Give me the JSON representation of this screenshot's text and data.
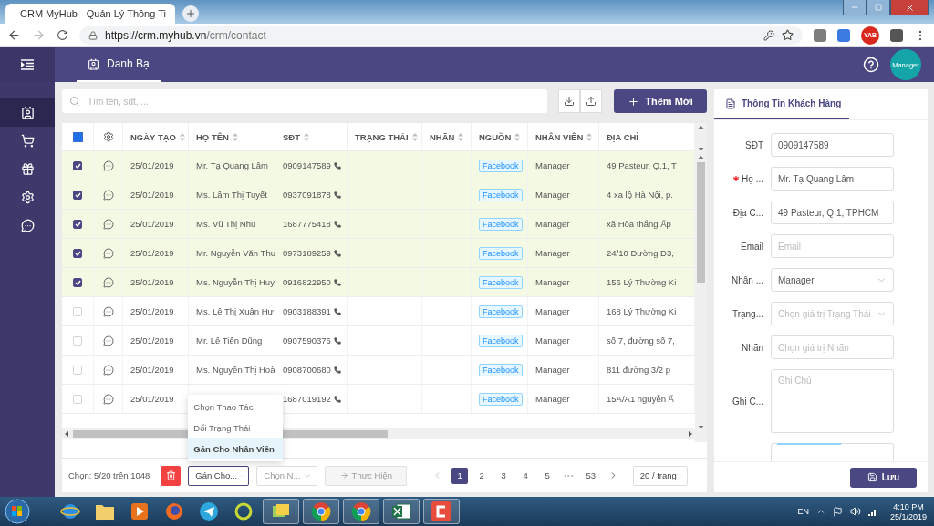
{
  "browser": {
    "tab_title": "CRM MyHub - Quản Lý Thông Ti",
    "url_host": "https://crm.myhub.vn",
    "url_path": "/crm/contact",
    "extension_badge": "YAB"
  },
  "header": {
    "tabs": [
      {
        "label": "Danh Bạ",
        "selected": true
      }
    ],
    "avatar": "Manager"
  },
  "sidebar": {
    "items": [
      {
        "kind": "contacts",
        "selected": true
      },
      {
        "kind": "cart",
        "selected": false
      },
      {
        "kind": "gift",
        "selected": false
      },
      {
        "kind": "settings",
        "selected": false
      },
      {
        "kind": "chat",
        "selected": false
      }
    ]
  },
  "toolbar": {
    "search": {
      "placeholder": "Tìm tên, sđt, ..."
    },
    "add_button": "Thêm Mới"
  },
  "table": {
    "select_all": {
      "indeterminate": true
    },
    "columns": [
      {
        "kind": "checkbox"
      },
      {
        "kind": "settings"
      },
      {
        "kind": "text",
        "label": "NGÀY TẠO",
        "sortable": true
      },
      {
        "kind": "text",
        "label": "HỌ TÊN",
        "sortable": true
      },
      {
        "kind": "text",
        "label": "SĐT",
        "sortable": true
      },
      {
        "kind": "text",
        "label": "TRẠNG THÁI",
        "sortable": true
      },
      {
        "kind": "text",
        "label": "NHÃN",
        "sortable": true
      },
      {
        "kind": "text",
        "label": "NGUỒN",
        "sortable": true
      },
      {
        "kind": "text",
        "label": "NHÂN VIÊN",
        "sortable": true
      },
      {
        "kind": "text",
        "label": "ĐỊA CHỈ",
        "sortable": false
      }
    ],
    "rows": [
      {
        "checked": true,
        "date": "25/01/2019",
        "name": "Mr. Tạ Quang Lâm",
        "phone": "0909147589",
        "source": "Facebook",
        "staff": "Manager",
        "address": "49 Pasteur, Q.1, T"
      },
      {
        "checked": true,
        "date": "25/01/2019",
        "name": "Ms. Lâm Thị Tuyết",
        "phone": "0937091878",
        "source": "Facebook",
        "staff": "Manager",
        "address": "4 xa lộ Hà Nội, p."
      },
      {
        "checked": true,
        "date": "25/01/2019",
        "name": "Ms. Vũ Thị Nhu",
        "phone": "1687775418",
        "source": "Facebook",
        "staff": "Manager",
        "address": "xã Hòa thắng Ấp"
      },
      {
        "checked": true,
        "date": "25/01/2019",
        "name": "Mr. Nguyễn Văn Thu",
        "phone": "0973189259",
        "source": "Facebook",
        "staff": "Manager",
        "address": "24/10 Đường D3,"
      },
      {
        "checked": true,
        "date": "25/01/2019",
        "name": "Ms. Nguyễn Thị Huy",
        "phone": "0916822950",
        "source": "Facebook",
        "staff": "Manager",
        "address": "156 Lý Thường Ki"
      },
      {
        "checked": false,
        "date": "25/01/2019",
        "name": "Ms. Lê Thị Xuân Hư",
        "phone": "0903188391",
        "source": "Facebook",
        "staff": "Manager",
        "address": "168 Lý Thường Ki"
      },
      {
        "checked": false,
        "date": "25/01/2019",
        "name": "Mr. Lê Tiến Dũng",
        "phone": "0907590376",
        "source": "Facebook",
        "staff": "Manager",
        "address": "số 7, đường số 7,"
      },
      {
        "checked": false,
        "date": "25/01/2019",
        "name": "Ms. Nguyễn Thị Hoà",
        "phone": "0908700680",
        "source": "Facebook",
        "staff": "Manager",
        "address": "811 đường 3/2 p"
      },
      {
        "checked": false,
        "date": "25/01/2019",
        "phone": "1687019192",
        "source": "Facebook",
        "staff": "Manager",
        "address": "15A/A1 nguyễn Ấ"
      }
    ]
  },
  "footer": {
    "selection_info": "Chọn: 5/20 trên 1048",
    "action_select": {
      "value": "Gán Cho...",
      "open": true
    },
    "action_menu": [
      {
        "label": "Chọn Thao Tác",
        "selected": false
      },
      {
        "label": "Đổi Trạng Thái",
        "selected": false
      },
      {
        "label": "Gán Cho Nhân Viên",
        "selected": true
      }
    ],
    "staff_select": {
      "placeholder": "Chọn N...",
      "disabled": true
    },
    "execute_button": {
      "label": "Thực Hiện",
      "disabled": true
    },
    "pages": [
      {
        "kind": "page",
        "label": "1",
        "selected": true
      },
      {
        "kind": "page",
        "label": "2",
        "selected": false
      },
      {
        "kind": "page",
        "label": "3",
        "selected": false
      },
      {
        "kind": "page",
        "label": "4",
        "selected": false
      },
      {
        "kind": "page",
        "label": "5",
        "selected": false
      },
      {
        "kind": "ellipsis",
        "label": "•••"
      },
      {
        "kind": "page",
        "label": "53",
        "selected": false
      }
    ],
    "page_size": "20 / trang"
  },
  "panel": {
    "tab": "Thông Tin Khách Hàng",
    "fields": [
      {
        "kind": "input",
        "label": "SĐT",
        "value": "0909147589",
        "required": false
      },
      {
        "kind": "input",
        "label": "Họ ...",
        "value": "Mr. Tạ Quang Lâm",
        "required": true
      },
      {
        "kind": "input",
        "label": "Địa C...",
        "value": "49 Pasteur, Q.1, TPHCM",
        "required": false
      },
      {
        "kind": "input",
        "label": "Email",
        "placeholder": "Email",
        "required": false
      },
      {
        "kind": "select",
        "label": "Nhân ...",
        "value": "Manager",
        "required": false
      },
      {
        "kind": "select",
        "label": "Trạng...",
        "placeholder": "Chọn giá trị Trạng Thái",
        "required": false
      },
      {
        "kind": "input",
        "label": "Nhãn",
        "placeholder": "Chọn giá trị Nhãn",
        "required": false
      },
      {
        "kind": "textarea",
        "label": "Ghi C...",
        "placeholder": "Ghi Chú",
        "required": false
      },
      {
        "kind": "upload"
      }
    ],
    "save_button": "Lưu"
  },
  "taskbar": {
    "apps": [
      {
        "kind": "ie",
        "running": false
      },
      {
        "kind": "folder",
        "running": false
      },
      {
        "kind": "media",
        "running": false
      },
      {
        "kind": "firefox",
        "running": false
      },
      {
        "kind": "telegram",
        "running": false
      },
      {
        "kind": "ring",
        "running": false
      },
      {
        "kind": "sheets",
        "running": true
      },
      {
        "kind": "chrome",
        "running": true
      },
      {
        "kind": "chrome",
        "running": true
      },
      {
        "kind": "excel",
        "running": true
      },
      {
        "kind": "camtasia",
        "running": true
      }
    ],
    "language": "EN",
    "time": "4:10 PM",
    "date": "25/1/2019"
  }
}
